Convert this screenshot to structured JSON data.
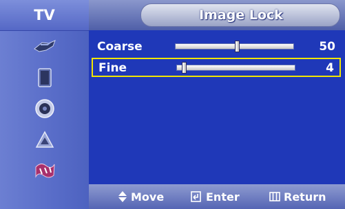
{
  "sidebar": {
    "title": "TV",
    "items": [
      {
        "icon": "picture-icon"
      },
      {
        "icon": "sound-icon"
      },
      {
        "icon": "channel-icon"
      },
      {
        "icon": "setup-icon"
      },
      {
        "icon": "input-icon"
      }
    ]
  },
  "header": {
    "title": "Image Lock"
  },
  "rows": [
    {
      "label": "Coarse",
      "value": "50",
      "level_percent": 50,
      "selected": false
    },
    {
      "label": "Fine",
      "value": "4",
      "level_percent": 4,
      "selected": true
    }
  ],
  "footer": {
    "move_label": "Move",
    "enter_label": "Enter",
    "return_label": "Return",
    "move_icon": "updown-arrow-icon",
    "enter_icon": "enter-icon",
    "return_icon": "menu-icon"
  },
  "colors": {
    "background": "#1f38b8",
    "highlight": "#f2e600",
    "text": "#ffffff"
  }
}
